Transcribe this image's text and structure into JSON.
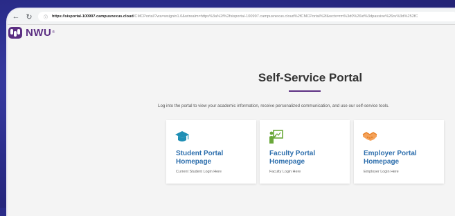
{
  "browser": {
    "url_host": "https://sisportal-100997.campusnexus.cloud",
    "url_rest": "/CMCPortal/?wa=wsignin1.0&wtrealm=https%3a%2f%2fsisportal-100997.campusnexus.cloud%2fCMCPortal%2f&wctx=rm%3d0%26id%3dpassive%26ru%3d%252fC"
  },
  "logo": {
    "text": "NWU",
    "reg": "®"
  },
  "portal": {
    "title": "Self-Service Portal",
    "intro": "Log into the portal to view your academic information, receive personalized communication, and use our self-service tools."
  },
  "cards": [
    {
      "icon": "graduation-cap-icon",
      "title": "Student Portal Homepage",
      "subtitle": "Current Student Login Here"
    },
    {
      "icon": "teacher-board-icon",
      "title": "Faculty Portal Homepage",
      "subtitle": "Faculty Login Here"
    },
    {
      "icon": "handshake-icon",
      "title": "Employer Portal Homepage",
      "subtitle": "Employer Login Here"
    }
  ],
  "colors": {
    "accent": "#5b2e82",
    "link": "#2e6fad",
    "icon_teal": "#1f8fb5",
    "icon_green": "#6aa83a",
    "icon_orange": "#e8832a"
  }
}
